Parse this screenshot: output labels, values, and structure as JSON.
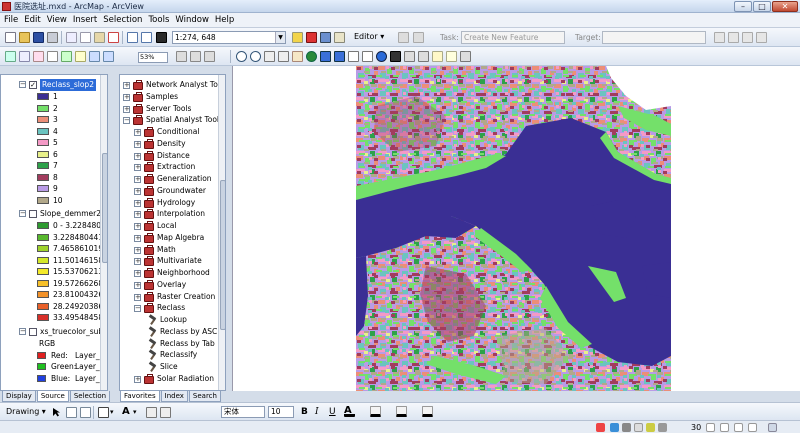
{
  "window": {
    "title": "医院选址.mxd - ArcMap - ArcView",
    "minimize": "–",
    "maximize": "□",
    "close": "✕"
  },
  "menu": [
    "File",
    "Edit",
    "View",
    "Insert",
    "Selection",
    "Tools",
    "Window",
    "Help"
  ],
  "toolbar": {
    "scale": "1:274, 648",
    "zoom_percent": "53%",
    "editor": "Editor ▾",
    "task_label": "Task:",
    "task_value": "Create New Feature",
    "target_label": "Target:"
  },
  "toc": {
    "layers": [
      {
        "name": "Reclass_slop2",
        "checked": true,
        "selected": true,
        "classes": [
          {
            "label": "1",
            "color": "#3a2f94"
          },
          {
            "label": "2",
            "color": "#74e06a"
          },
          {
            "label": "3",
            "color": "#ec8e78"
          },
          {
            "label": "4",
            "color": "#6bc4c0"
          },
          {
            "label": "5",
            "color": "#f49ac6"
          },
          {
            "label": "6",
            "color": "#e8f08a"
          },
          {
            "label": "7",
            "color": "#2ea14a"
          },
          {
            "label": "8",
            "color": "#a23c5e"
          },
          {
            "label": "9",
            "color": "#b99be6"
          },
          {
            "label": "10",
            "color": "#b2a88a"
          }
        ]
      },
      {
        "name": "Slope_demmer2",
        "checked": false,
        "selected": false,
        "classes": [
          {
            "label": "0 - 3.22848044",
            "color": "#2e9a30"
          },
          {
            "label": "3.228480441 -",
            "color": "#58b82e"
          },
          {
            "label": "7.465861019 -",
            "color": "#9ed22c"
          },
          {
            "label": "11.50146158 -",
            "color": "#d4e82a"
          },
          {
            "label": "15.53706213 -",
            "color": "#f4ea2a"
          },
          {
            "label": "19.57266268 -",
            "color": "#f6c02a"
          },
          {
            "label": "23.81004326 -",
            "color": "#f2922a"
          },
          {
            "label": "28.24920386 -",
            "color": "#e8602a"
          },
          {
            "label": "33.49548458 -",
            "color": "#d8302a"
          }
        ]
      },
      {
        "name": "xs_truecolor_sub.i",
        "checked": false,
        "selected": false,
        "sublabel": "RGB",
        "bands": [
          {
            "label": "Red:",
            "value": "Layer_1",
            "color": "#e02020"
          },
          {
            "label": "Green:",
            "value": "Layer_2",
            "color": "#20c020"
          },
          {
            "label": "Blue:",
            "value": "Layer_3",
            "color": "#2040e0"
          }
        ]
      }
    ],
    "tabs": [
      "Display",
      "Source",
      "Selection"
    ],
    "active_tab": "Source"
  },
  "catalog": {
    "items": [
      {
        "label": "Network Analyst Too",
        "level": 0,
        "expander": "+"
      },
      {
        "label": "Samples",
        "level": 0,
        "expander": "+"
      },
      {
        "label": "Server Tools",
        "level": 0,
        "expander": "+"
      },
      {
        "label": "Spatial Analyst Tools",
        "level": 0,
        "expander": "−"
      },
      {
        "label": "Conditional",
        "level": 1,
        "expander": "+"
      },
      {
        "label": "Density",
        "level": 1,
        "expander": "+"
      },
      {
        "label": "Distance",
        "level": 1,
        "expander": "+"
      },
      {
        "label": "Extraction",
        "level": 1,
        "expander": "+"
      },
      {
        "label": "Generalization",
        "level": 1,
        "expander": "+"
      },
      {
        "label": "Groundwater",
        "level": 1,
        "expander": "+"
      },
      {
        "label": "Hydrology",
        "level": 1,
        "expander": "+"
      },
      {
        "label": "Interpolation",
        "level": 1,
        "expander": "+"
      },
      {
        "label": "Local",
        "level": 1,
        "expander": "+"
      },
      {
        "label": "Map Algebra",
        "level": 1,
        "expander": "+"
      },
      {
        "label": "Math",
        "level": 1,
        "expander": "+"
      },
      {
        "label": "Multivariate",
        "level": 1,
        "expander": "+"
      },
      {
        "label": "Neighborhood",
        "level": 1,
        "expander": "+"
      },
      {
        "label": "Overlay",
        "level": 1,
        "expander": "+"
      },
      {
        "label": "Raster Creation",
        "level": 1,
        "expander": "+"
      },
      {
        "label": "Reclass",
        "level": 1,
        "expander": "−"
      },
      {
        "label": "Lookup",
        "level": 2,
        "expander": ""
      },
      {
        "label": "Reclass by ASC",
        "level": 2,
        "expander": ""
      },
      {
        "label": "Reclass by Tab",
        "level": 2,
        "expander": ""
      },
      {
        "label": "Reclassify",
        "level": 2,
        "expander": ""
      },
      {
        "label": "Slice",
        "level": 2,
        "expander": ""
      },
      {
        "label": "Solar Radiation",
        "level": 1,
        "expander": "+"
      }
    ],
    "tabs": [
      "Favorites",
      "Index",
      "Search"
    ],
    "active_tab": "Favorites"
  },
  "drawing_toolbar": {
    "label": "Drawing ▾",
    "font": "宋体",
    "size": "10",
    "bold": "B",
    "italic": "I",
    "underline": "U"
  },
  "status": {
    "coordinates": "30"
  },
  "map": {
    "water_color": "#3a2f94",
    "background": "#ffffff"
  }
}
